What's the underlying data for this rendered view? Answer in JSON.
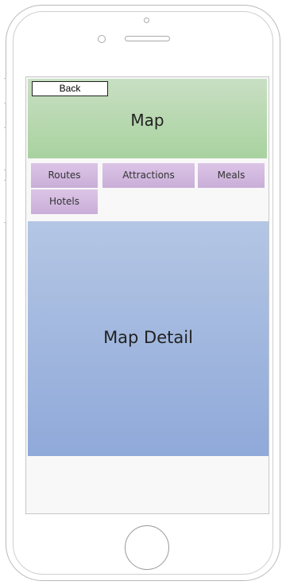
{
  "header": {
    "title": "Map",
    "back_label": "Back"
  },
  "tabs": [
    {
      "label": "Routes"
    },
    {
      "label": "Attractions"
    },
    {
      "label": "Meals"
    },
    {
      "label": "Hotels"
    }
  ],
  "map_detail": {
    "label": "Map Detail"
  },
  "colors": {
    "header_bg": "#b5d8ac",
    "tab_bg": "#d4bbe1",
    "map_detail_bg": "#a2b8df"
  }
}
